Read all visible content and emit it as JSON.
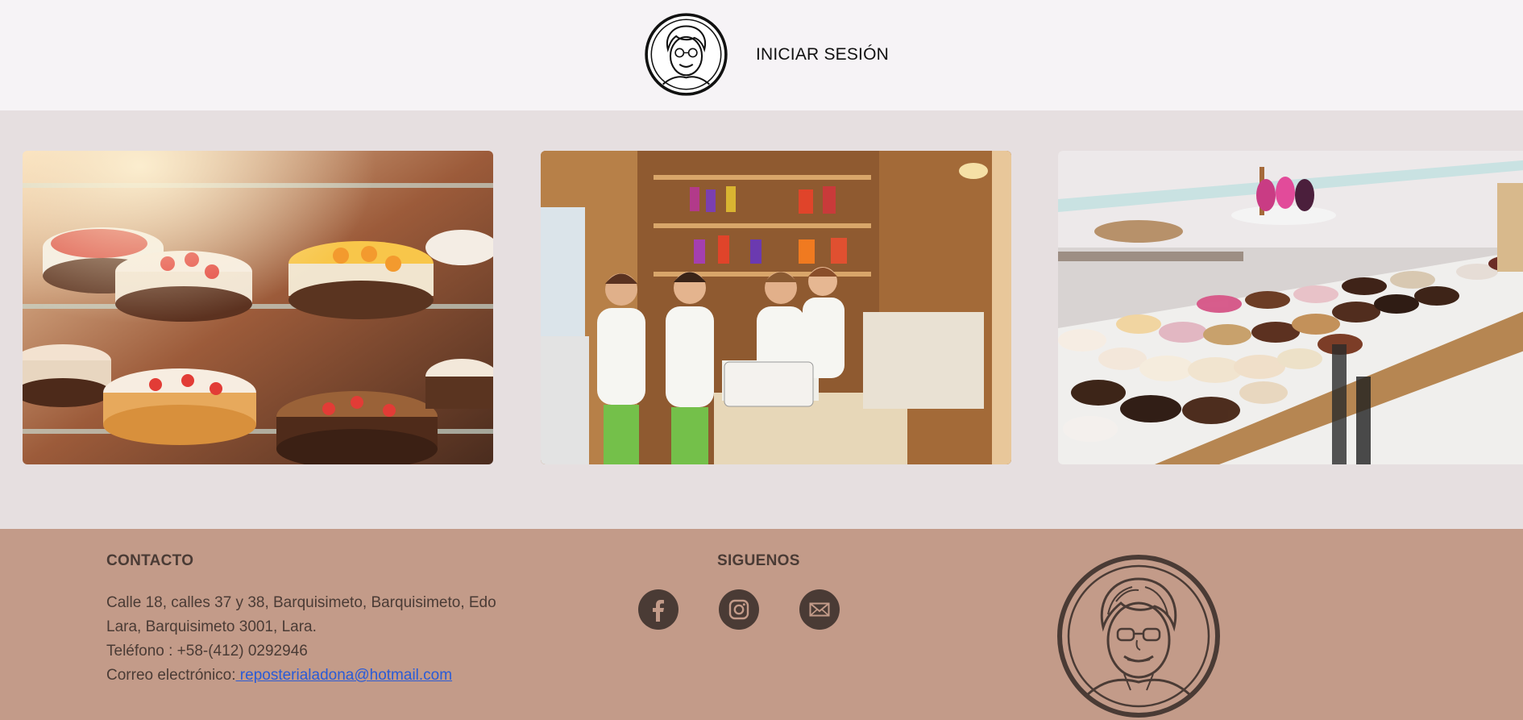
{
  "header": {
    "logo_icon": "grandma-portrait-logo",
    "login_label": "INICIAR SESIÓN"
  },
  "gallery": {
    "images": [
      {
        "name": "cake-display-case-photo",
        "subject": "cakes in glass display case"
      },
      {
        "name": "bakery-staff-photo",
        "subject": "four bakers in white uniforms at the shop counter"
      },
      {
        "name": "donut-table-photo",
        "subject": "table of decorated donuts and pastries"
      }
    ]
  },
  "footer": {
    "contact": {
      "title": "CONTACTO",
      "address_line_1": "Calle 18, calles 37 y 38, Barquisimeto, Barquisimeto, Edo",
      "address_line_2": "Lara, Barquisimeto 3001, Lara.",
      "phone": "Teléfono : +58-(412) 0292946",
      "email_label": "Correo electrónico:",
      "email": " reposterialadona@hotmail.com"
    },
    "follow": {
      "title": "SIGUENOS",
      "icons": [
        "facebook-icon",
        "instagram-icon",
        "email-icon"
      ]
    },
    "logo_icon": "grandma-portrait-logo"
  },
  "colors": {
    "header_bg": "#f6f3f6",
    "gallery_bg": "#e6dfe0",
    "footer_bg": "#c39b89",
    "footer_text": "#4a3b35",
    "link": "#2a5bd7"
  }
}
